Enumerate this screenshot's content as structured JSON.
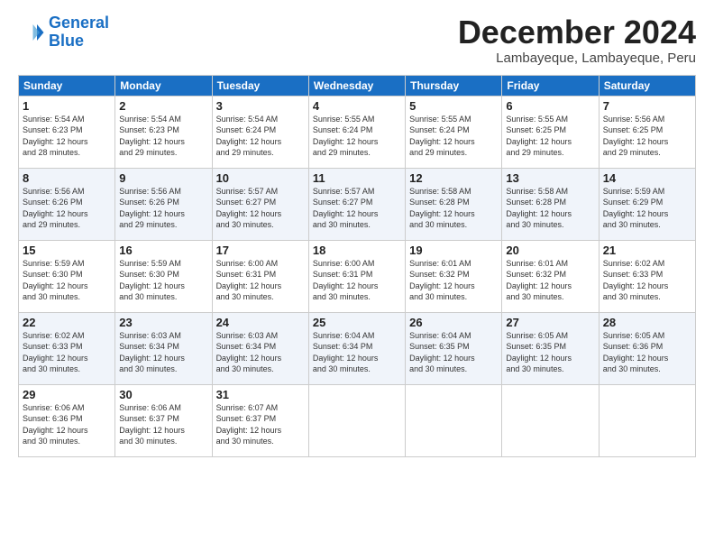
{
  "logo": {
    "line1": "General",
    "line2": "Blue"
  },
  "title": "December 2024",
  "subtitle": "Lambayeque, Lambayeque, Peru",
  "days_of_week": [
    "Sunday",
    "Monday",
    "Tuesday",
    "Wednesday",
    "Thursday",
    "Friday",
    "Saturday"
  ],
  "weeks": [
    [
      {
        "day": "1",
        "info": "Sunrise: 5:54 AM\nSunset: 6:23 PM\nDaylight: 12 hours\nand 28 minutes."
      },
      {
        "day": "2",
        "info": "Sunrise: 5:54 AM\nSunset: 6:23 PM\nDaylight: 12 hours\nand 29 minutes."
      },
      {
        "day": "3",
        "info": "Sunrise: 5:54 AM\nSunset: 6:24 PM\nDaylight: 12 hours\nand 29 minutes."
      },
      {
        "day": "4",
        "info": "Sunrise: 5:55 AM\nSunset: 6:24 PM\nDaylight: 12 hours\nand 29 minutes."
      },
      {
        "day": "5",
        "info": "Sunrise: 5:55 AM\nSunset: 6:24 PM\nDaylight: 12 hours\nand 29 minutes."
      },
      {
        "day": "6",
        "info": "Sunrise: 5:55 AM\nSunset: 6:25 PM\nDaylight: 12 hours\nand 29 minutes."
      },
      {
        "day": "7",
        "info": "Sunrise: 5:56 AM\nSunset: 6:25 PM\nDaylight: 12 hours\nand 29 minutes."
      }
    ],
    [
      {
        "day": "8",
        "info": "Sunrise: 5:56 AM\nSunset: 6:26 PM\nDaylight: 12 hours\nand 29 minutes."
      },
      {
        "day": "9",
        "info": "Sunrise: 5:56 AM\nSunset: 6:26 PM\nDaylight: 12 hours\nand 29 minutes."
      },
      {
        "day": "10",
        "info": "Sunrise: 5:57 AM\nSunset: 6:27 PM\nDaylight: 12 hours\nand 30 minutes."
      },
      {
        "day": "11",
        "info": "Sunrise: 5:57 AM\nSunset: 6:27 PM\nDaylight: 12 hours\nand 30 minutes."
      },
      {
        "day": "12",
        "info": "Sunrise: 5:58 AM\nSunset: 6:28 PM\nDaylight: 12 hours\nand 30 minutes."
      },
      {
        "day": "13",
        "info": "Sunrise: 5:58 AM\nSunset: 6:28 PM\nDaylight: 12 hours\nand 30 minutes."
      },
      {
        "day": "14",
        "info": "Sunrise: 5:59 AM\nSunset: 6:29 PM\nDaylight: 12 hours\nand 30 minutes."
      }
    ],
    [
      {
        "day": "15",
        "info": "Sunrise: 5:59 AM\nSunset: 6:30 PM\nDaylight: 12 hours\nand 30 minutes."
      },
      {
        "day": "16",
        "info": "Sunrise: 5:59 AM\nSunset: 6:30 PM\nDaylight: 12 hours\nand 30 minutes."
      },
      {
        "day": "17",
        "info": "Sunrise: 6:00 AM\nSunset: 6:31 PM\nDaylight: 12 hours\nand 30 minutes."
      },
      {
        "day": "18",
        "info": "Sunrise: 6:00 AM\nSunset: 6:31 PM\nDaylight: 12 hours\nand 30 minutes."
      },
      {
        "day": "19",
        "info": "Sunrise: 6:01 AM\nSunset: 6:32 PM\nDaylight: 12 hours\nand 30 minutes."
      },
      {
        "day": "20",
        "info": "Sunrise: 6:01 AM\nSunset: 6:32 PM\nDaylight: 12 hours\nand 30 minutes."
      },
      {
        "day": "21",
        "info": "Sunrise: 6:02 AM\nSunset: 6:33 PM\nDaylight: 12 hours\nand 30 minutes."
      }
    ],
    [
      {
        "day": "22",
        "info": "Sunrise: 6:02 AM\nSunset: 6:33 PM\nDaylight: 12 hours\nand 30 minutes."
      },
      {
        "day": "23",
        "info": "Sunrise: 6:03 AM\nSunset: 6:34 PM\nDaylight: 12 hours\nand 30 minutes."
      },
      {
        "day": "24",
        "info": "Sunrise: 6:03 AM\nSunset: 6:34 PM\nDaylight: 12 hours\nand 30 minutes."
      },
      {
        "day": "25",
        "info": "Sunrise: 6:04 AM\nSunset: 6:34 PM\nDaylight: 12 hours\nand 30 minutes."
      },
      {
        "day": "26",
        "info": "Sunrise: 6:04 AM\nSunset: 6:35 PM\nDaylight: 12 hours\nand 30 minutes."
      },
      {
        "day": "27",
        "info": "Sunrise: 6:05 AM\nSunset: 6:35 PM\nDaylight: 12 hours\nand 30 minutes."
      },
      {
        "day": "28",
        "info": "Sunrise: 6:05 AM\nSunset: 6:36 PM\nDaylight: 12 hours\nand 30 minutes."
      }
    ],
    [
      {
        "day": "29",
        "info": "Sunrise: 6:06 AM\nSunset: 6:36 PM\nDaylight: 12 hours\nand 30 minutes."
      },
      {
        "day": "30",
        "info": "Sunrise: 6:06 AM\nSunset: 6:37 PM\nDaylight: 12 hours\nand 30 minutes."
      },
      {
        "day": "31",
        "info": "Sunrise: 6:07 AM\nSunset: 6:37 PM\nDaylight: 12 hours\nand 30 minutes."
      },
      {
        "day": "",
        "info": ""
      },
      {
        "day": "",
        "info": ""
      },
      {
        "day": "",
        "info": ""
      },
      {
        "day": "",
        "info": ""
      }
    ]
  ]
}
